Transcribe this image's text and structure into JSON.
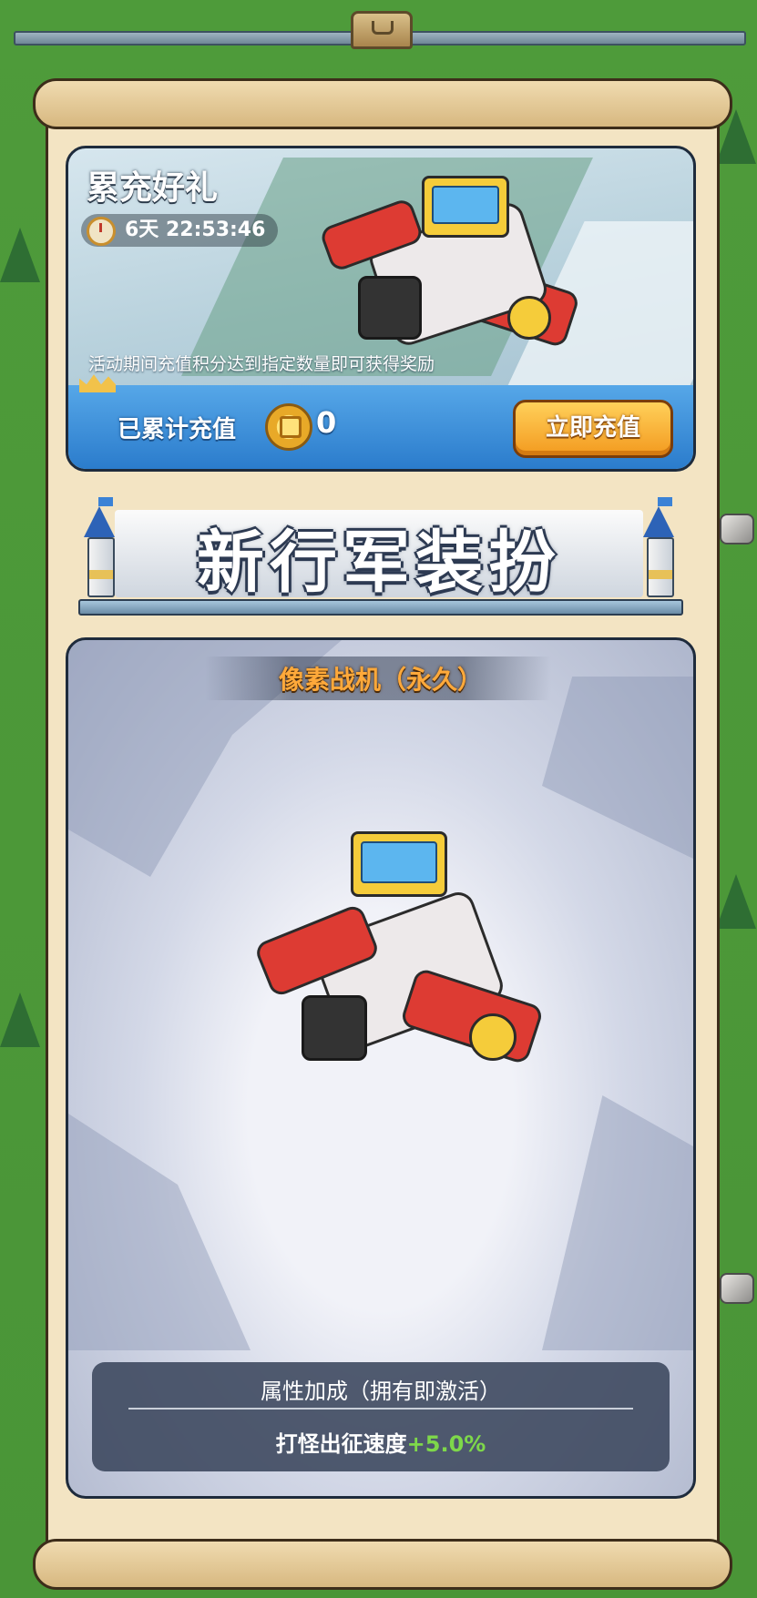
{
  "banner": {
    "title": "累充好礼",
    "timer": "6天 22:53:46",
    "description": "活动期间充值积分达到指定数量即可获得奖励",
    "total_label": "已累计充值",
    "total_value": "0",
    "recharge_button": "立即充值"
  },
  "section": {
    "title": "新行军装扮"
  },
  "skin": {
    "name": "像素战机（永久）",
    "attribute_title": "属性加成（拥有即激活）",
    "attribute_name": "打怪出征速度",
    "attribute_bonus": "+5.0%"
  },
  "colors": {
    "grass": "#4f9a3c",
    "parchment": "#f3e4c3",
    "button_orange": "#f39a1f",
    "skin_name_orange": "#ffa93a",
    "bonus_green": "#7ed84a",
    "banner_blue": "#2b7ccc"
  },
  "icons": [
    "clock-icon",
    "crown-icon",
    "coin-icon",
    "tower-icon",
    "plane-image"
  ]
}
